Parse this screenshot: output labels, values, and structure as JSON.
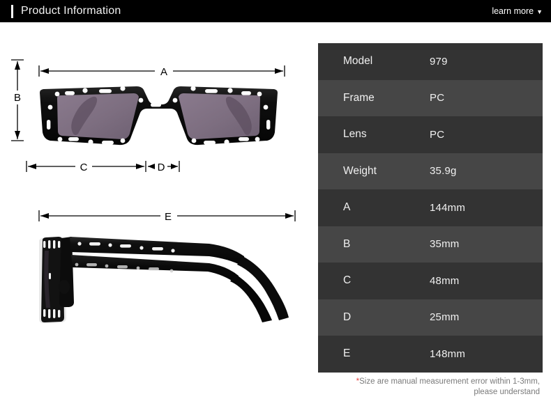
{
  "header": {
    "title": "Product Information",
    "learn_more_label": "learn more",
    "caret_glyph": "▼",
    "background_color": "#000000",
    "accent_color": "#ffffff"
  },
  "illustrations": {
    "front_view": {
      "name": "sunglasses-front-view",
      "dimension_a_label": "A",
      "dimension_b_label": "B",
      "dimension_c_label": "C",
      "dimension_d_label": "D",
      "frame_color": "#0d0d0d",
      "lens_color": "#7d6e80"
    },
    "side_view": {
      "name": "sunglasses-side-view",
      "dimension_e_label": "E",
      "frame_color": "#0d0d0d"
    }
  },
  "spec_table": {
    "row_color_dark": "#333333",
    "row_color_light": "#464646",
    "rows": [
      {
        "label": "Model",
        "value": "979"
      },
      {
        "label": "Frame",
        "value": "PC"
      },
      {
        "label": "Lens",
        "value": "PC"
      },
      {
        "label": "Weight",
        "value": "35.9g"
      },
      {
        "label": "A",
        "value": "144mm"
      },
      {
        "label": "B",
        "value": "35mm"
      },
      {
        "label": "C",
        "value": "48mm"
      },
      {
        "label": "D",
        "value": "25mm"
      },
      {
        "label": "E",
        "value": "148mm"
      }
    ]
  },
  "footnote": {
    "asterisk": "*",
    "line1": "Size are manual measurement error within 1-3mm,",
    "line2": "please understand",
    "asterisk_color": "#e8423f"
  }
}
